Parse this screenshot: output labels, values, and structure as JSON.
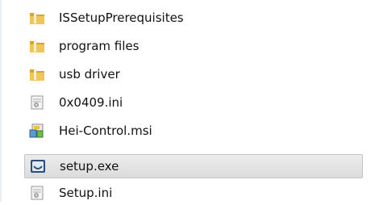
{
  "files": [
    {
      "name": "ISSetupPrerequisites",
      "icon": "folder-icon",
      "selected": false
    },
    {
      "name": "program files",
      "icon": "folder-icon",
      "selected": false
    },
    {
      "name": "usb driver",
      "icon": "folder-icon",
      "selected": false
    },
    {
      "name": "0x0409.ini",
      "icon": "ini-file-icon",
      "selected": false
    },
    {
      "name": "Hei-Control.msi",
      "icon": "msi-installer-icon",
      "selected": false
    },
    {
      "name": "setup.exe",
      "icon": "exe-setup-icon",
      "selected": true
    },
    {
      "name": "Setup.ini",
      "icon": "ini-file-icon",
      "selected": false
    }
  ],
  "colors": {
    "folder": "#e8b93a",
    "selection": "#dedede",
    "exe_blue": "#2a4d7a"
  }
}
